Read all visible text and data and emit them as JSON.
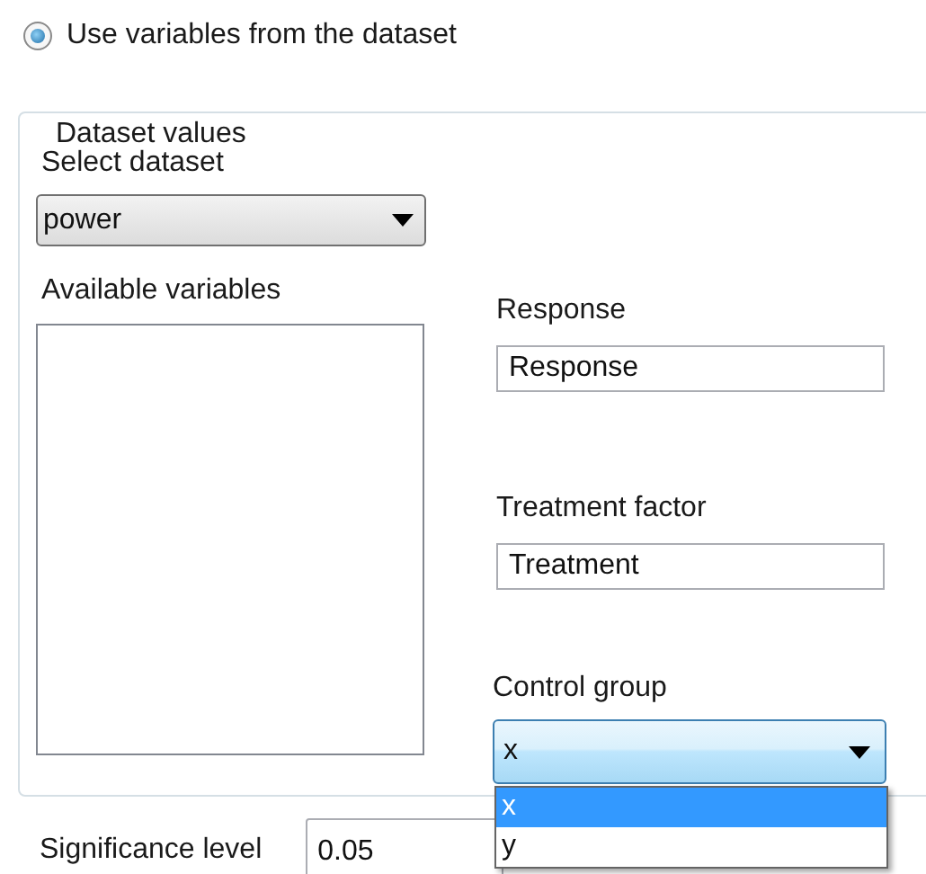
{
  "source_option": {
    "label": "Use variables from the dataset",
    "selected": true
  },
  "dataset_group": {
    "title": "Dataset values",
    "select_dataset": {
      "label": "Select dataset",
      "value": "power"
    },
    "available_variables": {
      "label": "Available variables"
    },
    "response": {
      "label": "Response",
      "value": "Response"
    },
    "treatment_factor": {
      "label": "Treatment factor",
      "value": "Treatment"
    },
    "control_group": {
      "label": "Control group",
      "value": "x",
      "expanded": true,
      "options": [
        {
          "label": "x",
          "selected": true
        },
        {
          "label": "y",
          "selected": false
        }
      ]
    }
  },
  "significance_level": {
    "label": "Significance level",
    "value": "0.05"
  }
}
